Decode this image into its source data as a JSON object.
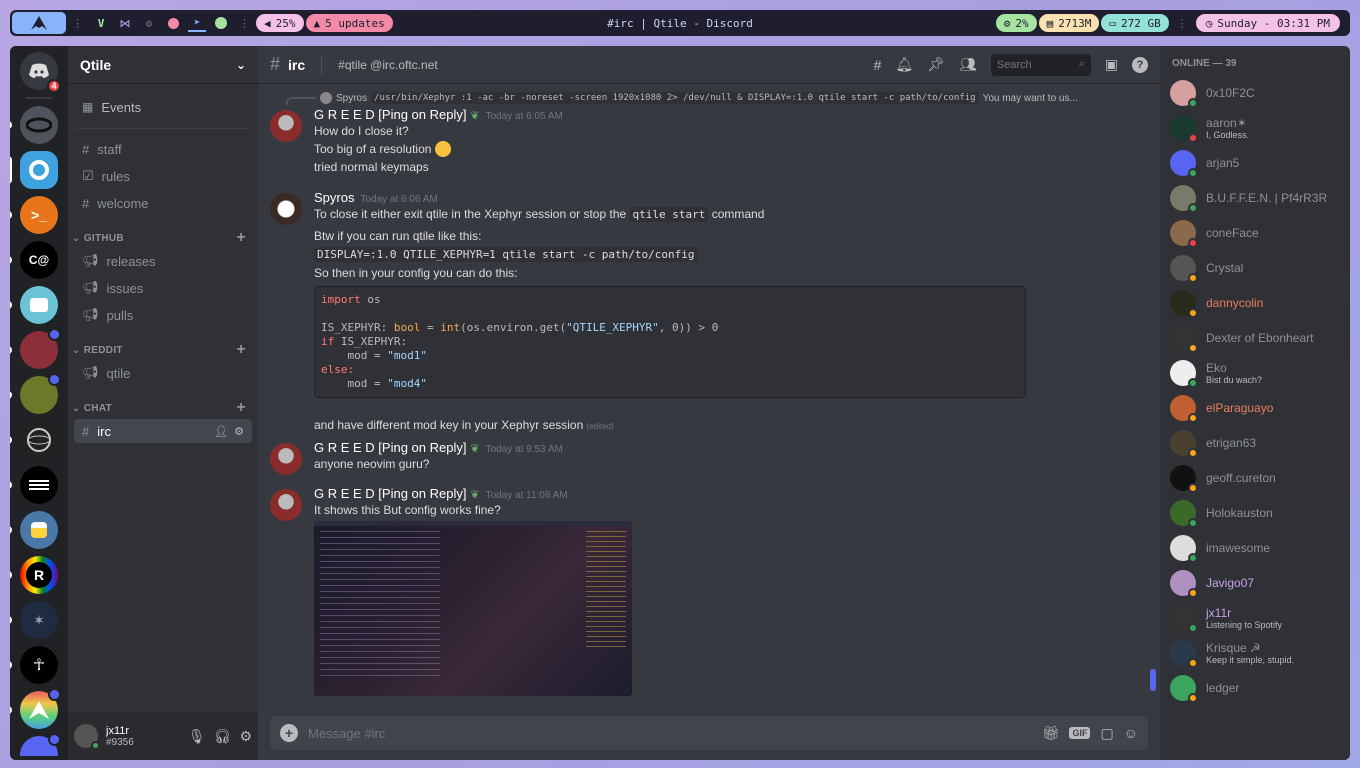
{
  "topbar": {
    "volume": "25%",
    "updates": "5 updates",
    "window_title": "#irc | Qtile - Discord",
    "cpu": "2%",
    "mem": "2713M",
    "disk": "272 GB",
    "datetime": "Sunday - 03:31 PM"
  },
  "server": {
    "name": "Qtile",
    "events": "Events",
    "channels_top": [
      "staff",
      "rules",
      "welcome"
    ],
    "categories": [
      {
        "name": "GITHUB",
        "channels": [
          "releases",
          "issues",
          "pulls"
        ]
      },
      {
        "name": "REDDIT",
        "channels": [
          "qtile"
        ]
      },
      {
        "name": "CHAT",
        "channels": [
          "irc"
        ]
      }
    ],
    "guild_badge": "4"
  },
  "user": {
    "name": "jx11r",
    "tag": "#9356"
  },
  "channel": {
    "name": "irc",
    "topic": "#qtile @irc.oftc.net",
    "search_placeholder": "Search",
    "composer_placeholder": "Message #irc"
  },
  "messages": {
    "reply": {
      "author": "Spyros",
      "code": "/usr/bin/Xephyr :1 -ac -br -noreset -screen 1920x1080 2> /dev/null & DISPLAY=:1.0 qtile start -c path/to/config",
      "rest": "You may want to us..."
    },
    "m1": {
      "author": "G R E E D [Ping on Reply]",
      "time": "Today at 6:05 AM",
      "lines": [
        "How do I close it?",
        "Too big of a resolution",
        "tried normal keymaps"
      ]
    },
    "m2": {
      "author": "Spyros",
      "time": "Today at 6:06 AM",
      "l1a": "To close it either exit qtile in the Xephyr session or stop the",
      "l1code": "qtile start",
      "l1b": "command",
      "l2": "Btw if you can run qtile like this:",
      "l3code": "DISPLAY=:1.0 QTILE_XEPHYR=1 qtile start -c path/to/config",
      "l4": "So then in your config you can do this:",
      "l5": "and have different mod key in your Xephyr session",
      "edited": "(edited)"
    },
    "m3": {
      "author": "G R E E D [Ping on Reply]",
      "time": "Today at 9:53 AM",
      "text": "anyone neovim guru?"
    },
    "m4": {
      "author": "G R E E D [Ping on Reply]",
      "time": "Today at 11:08 AM",
      "text": "It shows this But config works fine?"
    }
  },
  "code": {
    "import": "import",
    "os": " os",
    "isx": "IS_XEPHYR: ",
    "bool": "bool",
    "eq": " = ",
    "int": "int",
    "env": "(os.environ.get(",
    "qx": "\"QTILE_XEPHYR\"",
    "rest": ", 0)) > 0",
    "if": "if",
    "ifrest": " IS_XEPHYR:",
    "mod": "    mod = ",
    "mod1": "\"mod1\"",
    "else": "else:",
    "mod4": "\"mod4\""
  },
  "members_header": "ONLINE — 39",
  "members": [
    {
      "name": "0x10F2C",
      "sub": "",
      "color": "#8e9297",
      "status": "#3ba55d"
    },
    {
      "name": "aaron✶",
      "sub": "I, Godless.",
      "color": "#8e9297",
      "status": "#ed4245"
    },
    {
      "name": "arjan5",
      "sub": "",
      "color": "#8e9297",
      "status": "#3ba55d"
    },
    {
      "name": "B.U.F.F.E.N. | Pf4rR3R",
      "sub": "",
      "color": "#8e9297",
      "status": "#3ba55d"
    },
    {
      "name": "coneFace",
      "sub": "",
      "color": "#8e9297",
      "status": "#ed4245"
    },
    {
      "name": "Crystal",
      "sub": "",
      "color": "#8e9297",
      "status": "#faa61a"
    },
    {
      "name": "dannycolin",
      "sub": "",
      "color": "#e67e5f",
      "status": "#faa61a"
    },
    {
      "name": "Dexter of Ebonheart",
      "sub": "",
      "color": "#8e9297",
      "status": "#faa61a"
    },
    {
      "name": "Eko",
      "sub": "Bist du wach?",
      "color": "#8e9297",
      "status": "#3ba55d"
    },
    {
      "name": "elParaguayo",
      "sub": "",
      "color": "#e67e5f",
      "status": "#faa61a"
    },
    {
      "name": "etrigan63",
      "sub": "",
      "color": "#8e9297",
      "status": "#faa61a"
    },
    {
      "name": "geoff.cureton",
      "sub": "",
      "color": "#8e9297",
      "status": "#faa61a"
    },
    {
      "name": "Holokauston",
      "sub": "",
      "color": "#8e9297",
      "status": "#3ba55d"
    },
    {
      "name": "imawesome",
      "sub": "",
      "color": "#8e9297",
      "status": "#3ba55d"
    },
    {
      "name": "Javigo07",
      "sub": "",
      "color": "#c9a3e6",
      "status": "#faa61a"
    },
    {
      "name": "jx11r",
      "sub": "Listening to Spotify",
      "color": "#c9a3e6",
      "status": "#3ba55d"
    },
    {
      "name": "Krisque ☭",
      "sub": "Keep it simple, stupid.",
      "color": "#8e9297",
      "status": "#faa61a"
    },
    {
      "name": "ledger",
      "sub": "",
      "color": "#8e9297",
      "status": "#faa61a"
    }
  ]
}
